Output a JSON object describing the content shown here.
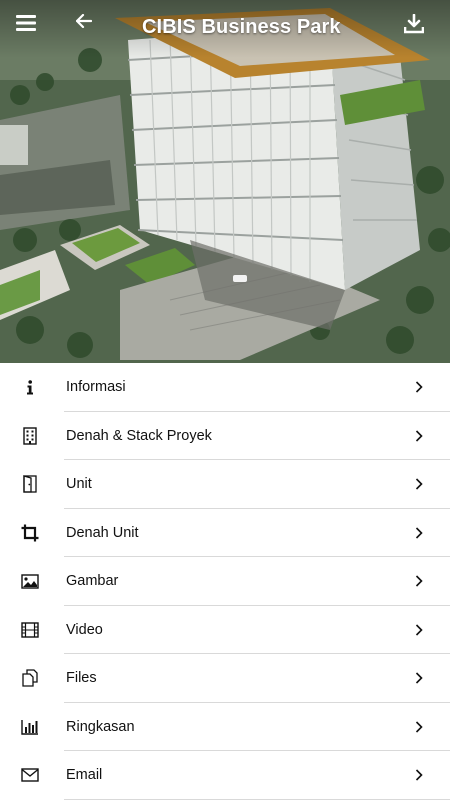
{
  "header": {
    "title": "CIBIS Business Park",
    "menu_icon": "hamburger-menu-icon",
    "back_icon": "arrow-left-icon",
    "download_icon": "download-icon"
  },
  "menu": {
    "items": [
      {
        "label": "Informasi",
        "icon": "info-icon"
      },
      {
        "label": "Denah & Stack Proyek",
        "icon": "building-icon"
      },
      {
        "label": "Unit",
        "icon": "door-icon"
      },
      {
        "label": "Denah Unit",
        "icon": "crop-icon"
      },
      {
        "label": "Gambar",
        "icon": "image-icon"
      },
      {
        "label": "Video",
        "icon": "film-icon"
      },
      {
        "label": "Files",
        "icon": "files-icon"
      },
      {
        "label": "Ringkasan",
        "icon": "bar-chart-icon"
      },
      {
        "label": "Email",
        "icon": "envelope-icon"
      }
    ]
  },
  "colors": {
    "accent_roof": "#b8832e",
    "text": "#111111",
    "divider": "#d9d9d9"
  }
}
